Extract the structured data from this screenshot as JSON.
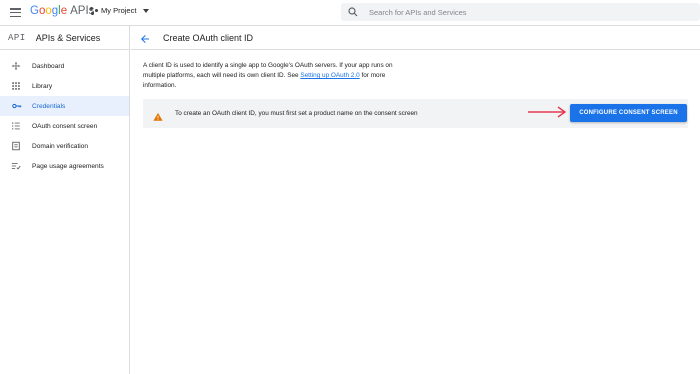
{
  "topbar": {
    "logo_google": [
      "G",
      "o",
      "o",
      "g",
      "l",
      "e"
    ],
    "logo_apis": "APIs",
    "project_name": "My Project",
    "search_placeholder": "Search for APIs and Services"
  },
  "sidebar": {
    "badge": "API",
    "title": "APIs & Services",
    "items": [
      {
        "label": "Dashboard",
        "icon": "dashboard-icon",
        "active": false
      },
      {
        "label": "Library",
        "icon": "library-icon",
        "active": false
      },
      {
        "label": "Credentials",
        "icon": "key-icon",
        "active": true
      },
      {
        "label": "OAuth consent screen",
        "icon": "consent-icon",
        "active": false
      },
      {
        "label": "Domain verification",
        "icon": "domain-icon",
        "active": false
      },
      {
        "label": "Page usage agreements",
        "icon": "agreements-icon",
        "active": false
      }
    ]
  },
  "main": {
    "title": "Create OAuth client ID",
    "description_pre": "A client ID is used to identify a single app to Google's OAuth servers. If your app runs on multiple platforms, each will need its own client ID. See ",
    "description_link": "Setting up OAuth 2.0",
    "description_post": " for more information.",
    "notice_text": "To create an OAuth client ID, you must first set a product name on the consent screen",
    "cta_label": "CONFIGURE CONSENT SCREEN"
  },
  "colors": {
    "accent": "#1a73e8",
    "active_bg": "#e8f0fe",
    "warning": "#e37400",
    "arrow": "#e53950"
  }
}
